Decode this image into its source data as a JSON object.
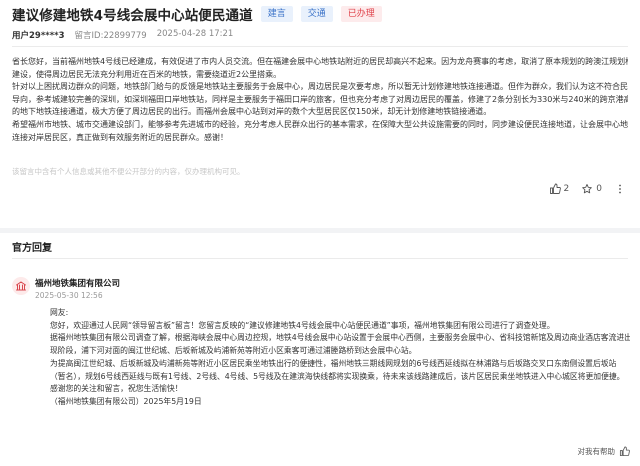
{
  "post": {
    "title": "建议修建地铁4号线会展中心站便民通道",
    "tags": [
      {
        "label": "建言",
        "color": "#3a72c8"
      },
      {
        "label": "交通",
        "color": "#3a72c8"
      },
      {
        "label": "已办理",
        "color": "#e0434b"
      }
    ],
    "user": "用户29****3",
    "message_id": "留言ID:22899779",
    "time": "2025-04-28 17:21",
    "body": [
      "省长您好，当前福州地铁4号线已经建成，有效促进了市内人员交流。但在福建会展中心地铁站附近的居民却高兴不起来。因为龙舟赛事的考虑，取消了原本规划的跨澳江规划桥的",
      "建设，使得周边居民无法充分利用近在百米的地铁，需要绕道近2公里搭乘。",
      "  针对以上困扰周边群众的问题，地铁部门给与的反馈是地铁站主要服务于会展中心，周边居民是次要考虑，所以暂无计划修建地铁连接通道。但作为群众，我们认为这不符合民生",
      "导向，参考城建较完善的深圳，如深圳福田口岸地铁站，同样是主要服务于福田口岸的旅客，但也充分考虑了对周边居民的覆盖，修建了2条分别长为330米与240米的跨京港高速",
      "的地下地铁连接通道，极大方便了周边居民的出行。而福州会展中心站到对岸的数个大型居民区仅150米，却无计划修建地铁链接通道。",
      "希望福州市地铁、城市交通建设部门，能够参考先进城市的经验，充分考虑人民群众出行的基本需求，在保障大型公共设施需要的同时，同步建设便民连接地道，让会展中心地铁站",
      "连接对岸居民区，真正做到有效服务附近的居民群众。感谢！"
    ],
    "note": "该留言中含有个人信息或其他不便公开部分的内容，仅办理机构可见。",
    "likes": "2",
    "comments": "0"
  },
  "reply_section": {
    "heading": "官方回复",
    "org": "福州地铁集团有限公司",
    "date": "2025-05-30 12:56",
    "paragraphs": [
      "网友:",
      "    您好，欢迎通过人民网“领导留言板”留言！您留言反映的“建议修建地铁4号线会展中心站便民通道”事项，福州地铁集团有限公司进行了调查处理。",
      "    据福州地铁集团有限公司调查了解，根据海峡会展中心周边控规，地铁4号线会展中心站设置于会展中心西侧，主要服务会展中心、省科技馆新馆及周边商业酒店客流进出。",
      "现阶段，浦下河对面的闽江世纪城、后坂新城及屿浦新苑等附近小区乘客可通过浦塍路桥到达会展中心站。",
      "    为提高闽江世纪城、后坂新城及屿浦新苑等附近小区居民乘坐地铁出行的便捷性，福州地铁三期线网规划的6号线西延线拟在林浦路与后坂路交叉口东南侧设置后坂站",
      "（暂名），规划6号线西延线与既有1号线、2号线、4号线、5号线及在建滨海快线都将实现换乘，待未来该线路建成后，该片区居民乘坐地铁进入中心城区将更加便捷。",
      "    感谢您的关注和留言，祝您生活愉快！",
      "    （福州地铁集团有限公司）2025年5月19日"
    ],
    "helpful_label": "对我有帮助"
  }
}
